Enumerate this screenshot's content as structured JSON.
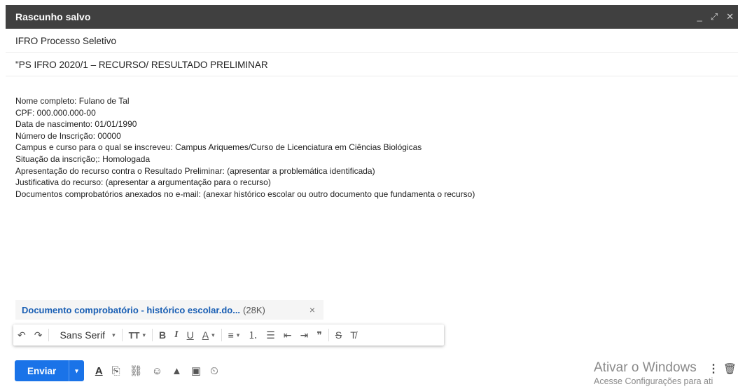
{
  "window": {
    "title": "Rascunho salvo",
    "controls": {
      "minimize": "_",
      "expand": "⤢",
      "close": "✕"
    }
  },
  "to": "IFRO Processo Seletivo",
  "subject": "\"PS IFRO 2020/1 – RECURSO/ RESULTADO PRELIMINAR",
  "body_lines": [
    "Nome completo: Fulano de Tal",
    "CPF:  000.000.000-00",
    "Data de nascimento: 01/01/1990",
    "Número de Inscrição: 00000",
    "Campus e curso para o qual se inscreveu: Campus Ariquemes/Curso de Licenciatura em Ciências Biológicas",
    "Situação da inscrição;: Homologada",
    "Apresentação do recurso contra o Resultado Preliminar: (apresentar a problemática identificada)",
    "Justificativa do recurso: (apresentar a argumentação para o recurso)",
    "Documentos comprobatórios anexados no e-mail: (anexar histórico escolar ou outro documento que fundamenta o recurso)"
  ],
  "attachment": {
    "name": "Documento comprobatório - histórico escolar.do...",
    "size": "(28K)",
    "close": "×"
  },
  "toolbar": {
    "undo": "↶",
    "redo": "↷",
    "font": "Sans Serif",
    "caret": "▾",
    "size": "TT",
    "bold": "B",
    "italic": "I",
    "underline": "U",
    "text_color": "A",
    "align": "≡",
    "numbered": "⒈",
    "bulleted": "☰",
    "indent_less": "⇤",
    "indent_more": "⇥",
    "quote": "❞",
    "strike": "S",
    "clear": "T̸"
  },
  "send": {
    "label": "Enviar",
    "caret": "▾"
  },
  "bottom_icons": {
    "format": "A",
    "attach": "⎘",
    "link": "⛓",
    "emoji": "☺",
    "drive": "▲",
    "photo": "▣",
    "confidential": "⏲"
  },
  "more": "⋮",
  "trash": "🗑",
  "watermark": {
    "line1": "Ativar o Windows",
    "line2": "Acesse Configurações para ati"
  },
  "colors": {
    "titlebar": "#404040",
    "send": "#1a73e8",
    "attachment_link": "#1a5fb4"
  }
}
